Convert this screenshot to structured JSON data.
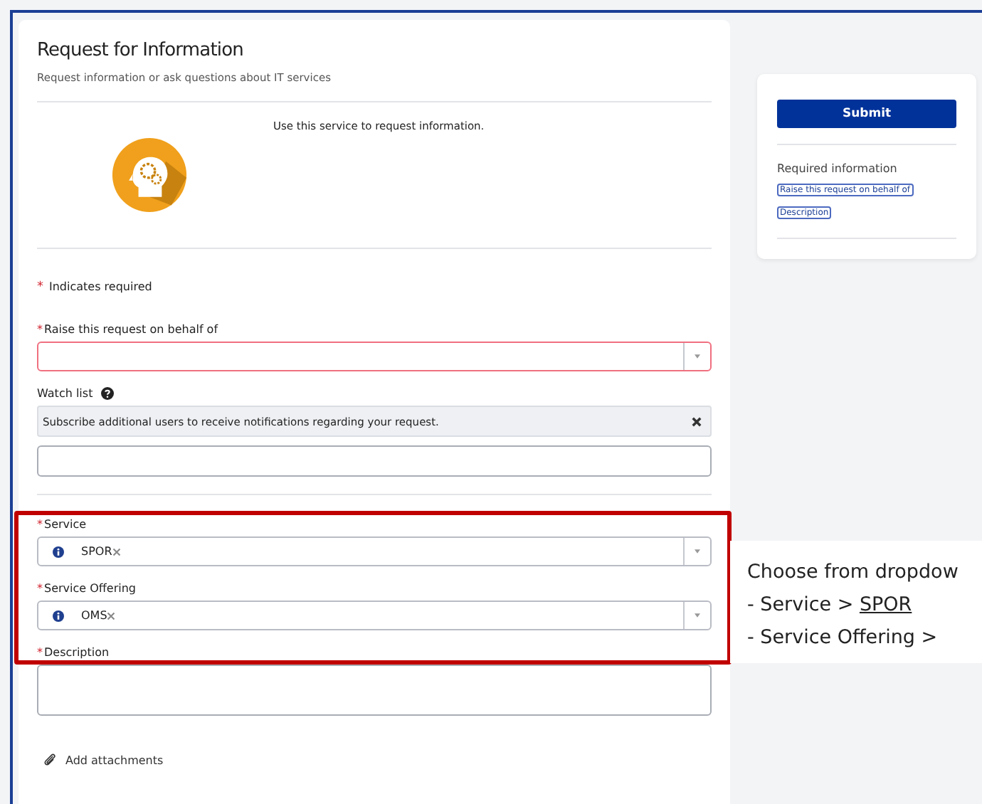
{
  "required_mark": "*",
  "form": {
    "title": "Request for Information",
    "subtitle": "Request information or ask questions about IT services",
    "intro": "Use this service to request information.",
    "required_note": "Indicates required",
    "fields": [
      {
        "kind": "select",
        "label": "Raise this request on behalf of",
        "required": true,
        "invalid": true
      },
      {
        "kind": "watchlist",
        "label": "Watch list",
        "hint": "Subscribe additional users to receive notifications regarding your request."
      },
      {
        "kind": "select",
        "label": "Service",
        "required": true,
        "invalid": false,
        "value": "SPOR"
      },
      {
        "kind": "select",
        "label": "Service Offering",
        "required": true,
        "invalid": false,
        "value": "OMS"
      },
      {
        "kind": "textarea",
        "label": "Description",
        "required": true
      }
    ],
    "attachments": "Add attachments"
  },
  "sidebar": {
    "submit": "Submit",
    "required_title": "Required information",
    "required_items": [
      "Raise this request on behalf of",
      "Description"
    ]
  },
  "annotation": {
    "heading": "Choose from dropdow",
    "lines": [
      {
        "prefix": "- Service > ",
        "value": "SPOR"
      },
      {
        "prefix": "- Service Offering >"
      }
    ]
  }
}
